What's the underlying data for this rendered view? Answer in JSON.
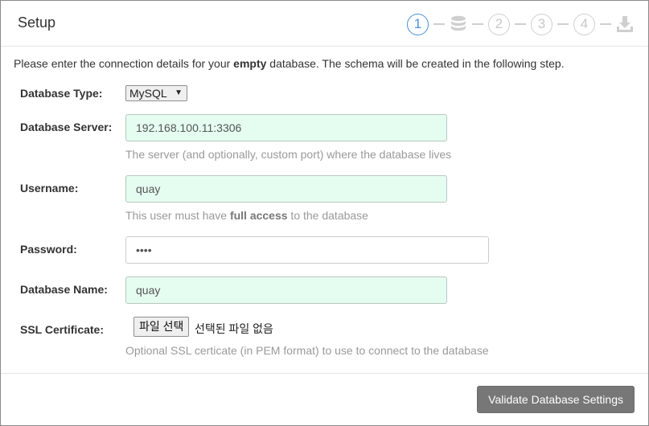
{
  "header": {
    "title": "Setup",
    "steps": [
      "1",
      "2",
      "3",
      "4"
    ],
    "step_icons": [
      "database-icon",
      "download-icon"
    ],
    "active_color": "#4a90d9"
  },
  "intro": {
    "before": "Please enter the connection details for your ",
    "bold": "empty",
    "after": " database. The schema will be created in the following step."
  },
  "form": {
    "db_type_label": "Database Type:",
    "db_type_value": "MySQL",
    "server_label": "Database Server:",
    "server_value": "192.168.100.11:3306",
    "server_help": "The server (and optionally, custom port) where the database lives",
    "username_label": "Username:",
    "username_value": "quay",
    "username_help_before": "This user must have ",
    "username_help_bold": "full access",
    "username_help_after": " to the database",
    "password_label": "Password:",
    "password_value": "••••",
    "dbname_label": "Database Name:",
    "dbname_value": "quay",
    "ssl_label": "SSL Certificate:",
    "ssl_button": "파일 선택",
    "ssl_status": "선택된 파일 없음",
    "ssl_help": "Optional SSL certicate (in PEM format) to use to connect to the database"
  },
  "footer": {
    "validate_label": "Validate Database Settings"
  }
}
